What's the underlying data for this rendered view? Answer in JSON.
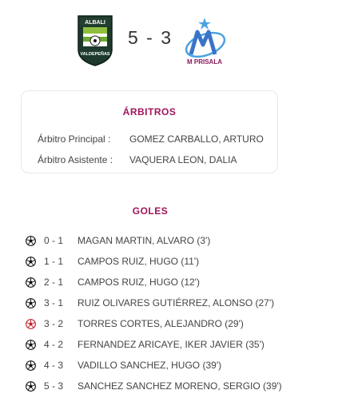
{
  "match": {
    "score": "5 - 3",
    "home_crest": {
      "icon": "albali-valdepenas-crest-icon",
      "name": "ALBALI",
      "town": "VALDEPEÑAS",
      "brand_color": "#1d3a2c"
    },
    "away_crest": {
      "icon": "movistar-inter-crest-icon",
      "logo_text": "M PRISALA",
      "brand_color": "#3a74c9"
    }
  },
  "referees": {
    "title": "ÁRBITROS",
    "rows": [
      {
        "label": "Árbitro Principal :",
        "value": "GOMEZ CARBALLO, ARTURO"
      },
      {
        "label": "Árbitro Asistente :",
        "value": "VAQUERA LEON, DALIA"
      }
    ]
  },
  "goals": {
    "title": "GOLES",
    "items": [
      {
        "score": "0 - 1",
        "scorer": "MAGAN MARTIN, ALVARO (3')",
        "icon": "soccer-ball-icon",
        "own_goal": false
      },
      {
        "score": "1 - 1",
        "scorer": "CAMPOS RUIZ, HUGO (11')",
        "icon": "soccer-ball-icon",
        "own_goal": false
      },
      {
        "score": "2 - 1",
        "scorer": "CAMPOS RUIZ, HUGO (12')",
        "icon": "soccer-ball-icon",
        "own_goal": false
      },
      {
        "score": "3 - 1",
        "scorer": "RUIZ OLIVARES GUTIÉRREZ, ALONSO (27')",
        "icon": "soccer-ball-icon",
        "own_goal": false
      },
      {
        "score": "3 - 2",
        "scorer": "TORRES CORTES, ALEJANDRO (29')",
        "icon": "soccer-ball-red-icon",
        "own_goal": true
      },
      {
        "score": "4 - 2",
        "scorer": "FERNANDEZ ARICAYE, IKER JAVIER (35')",
        "icon": "soccer-ball-icon",
        "own_goal": false
      },
      {
        "score": "4 - 3",
        "scorer": "VADILLO SANCHEZ, HUGO (39')",
        "icon": "soccer-ball-icon",
        "own_goal": false
      },
      {
        "score": "5 - 3",
        "scorer": "SANCHEZ SANCHEZ MORENO, SERGIO (39')",
        "icon": "soccer-ball-icon",
        "own_goal": false
      }
    ]
  },
  "colors": {
    "accent": "#a0145a",
    "text": "#444444",
    "own_goal_ball": "#c0202a"
  }
}
